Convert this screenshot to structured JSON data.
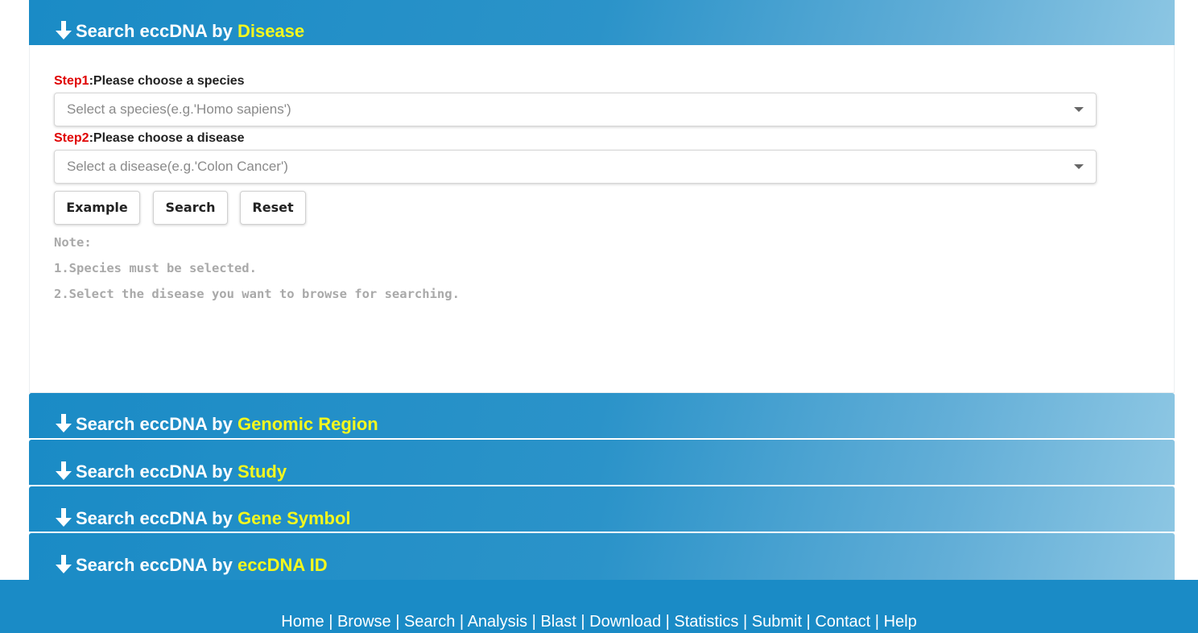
{
  "panels": [
    {
      "prefix": "Search eccDNA by ",
      "highlight": "Disease",
      "open": true
    },
    {
      "prefix": "Search eccDNA by ",
      "highlight": "Genomic Region",
      "open": false
    },
    {
      "prefix": "Search eccDNA by ",
      "highlight": "Study",
      "open": false
    },
    {
      "prefix": "Search eccDNA by ",
      "highlight": "Gene Symbol",
      "open": false
    },
    {
      "prefix": "Search eccDNA by ",
      "highlight": "eccDNA ID",
      "open": false
    }
  ],
  "form": {
    "step1": {
      "tag": "Step1",
      "text": ":Please choose a species",
      "placeholder": "Select a species(e.g.'Homo sapiens')"
    },
    "step2": {
      "tag": "Step2",
      "text": ":Please choose a disease",
      "placeholder": "Select a disease(e.g.'Colon Cancer')"
    },
    "buttons": {
      "example": "Example",
      "search": "Search",
      "reset": "Reset"
    },
    "notes": {
      "title": "Note:",
      "line1": "1.Species must be selected.",
      "line2": "2.Select the disease you want to browse for searching."
    }
  },
  "footer": {
    "links": [
      "Home",
      "Browse",
      "Search",
      "Analysis",
      "Blast",
      "Download",
      "Statistics",
      "Submit",
      "Contact",
      "Help"
    ],
    "separator": " | "
  },
  "colors": {
    "header": "#1a8bc6",
    "highlight": "#f4f71e",
    "step_tag": "#e00000"
  },
  "icons": {
    "panel_arrow": "arrow-down-icon",
    "select_caret": "caret-down-icon"
  }
}
